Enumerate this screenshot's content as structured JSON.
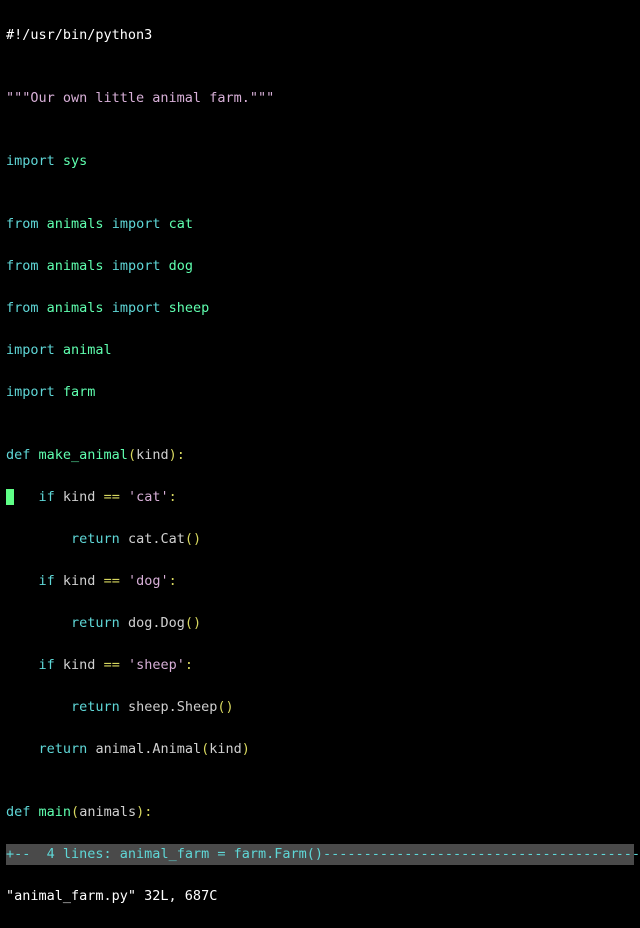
{
  "file": {
    "shebang": "#!/usr/bin/python3",
    "docstring": "\"\"\"Our own little animal farm.\"\"\"",
    "imports": {
      "sys": {
        "kw1": "import",
        "mod": "sys"
      },
      "cat": {
        "kw1": "from",
        "mod": "animals",
        "kw2": "import",
        "name": "cat"
      },
      "dog": {
        "kw1": "from",
        "mod": "animals",
        "kw2": "import",
        "name": "dog"
      },
      "sheep": {
        "kw1": "from",
        "mod": "animals",
        "kw2": "import",
        "name": "sheep"
      },
      "animal": {
        "kw1": "import",
        "mod": "animal"
      },
      "farm": {
        "kw1": "import",
        "mod": "farm"
      }
    },
    "funcs": {
      "make_animal": {
        "def": "def",
        "name": "make_animal",
        "sig_open": "(",
        "arg": "kind",
        "sig_close": "):",
        "body": {
          "if1": {
            "kw": "if",
            "var": "kind",
            "op": "==",
            "lit": "'cat'",
            "colon": ":"
          },
          "ret1": {
            "kw": "return",
            "expr": "cat.Cat",
            "par": "()"
          },
          "if2": {
            "kw": "if",
            "var": "kind",
            "op": "==",
            "lit": "'dog'",
            "colon": ":"
          },
          "ret2": {
            "kw": "return",
            "expr": "dog.Dog",
            "par": "()"
          },
          "if3": {
            "kw": "if",
            "var": "kind",
            "op": "==",
            "lit": "'sheep'",
            "colon": ":"
          },
          "ret3": {
            "kw": "return",
            "expr": "sheep.Sheep",
            "par": "()"
          },
          "ret4": {
            "kw": "return",
            "expr": "animal.Animal",
            "par_open": "(",
            "arg": "kind",
            "par_close": ")"
          }
        }
      },
      "main": {
        "def": "def",
        "name": "main",
        "sig_open": "(",
        "arg": "animals",
        "sig_close": "):"
      }
    },
    "fold": {
      "prefix": "+--  ",
      "count": "4 lines:",
      "preview": " animal_farm = farm.Farm()"
    }
  },
  "status": {
    "text": "\"animal_farm.py\" 32L, 687C"
  }
}
